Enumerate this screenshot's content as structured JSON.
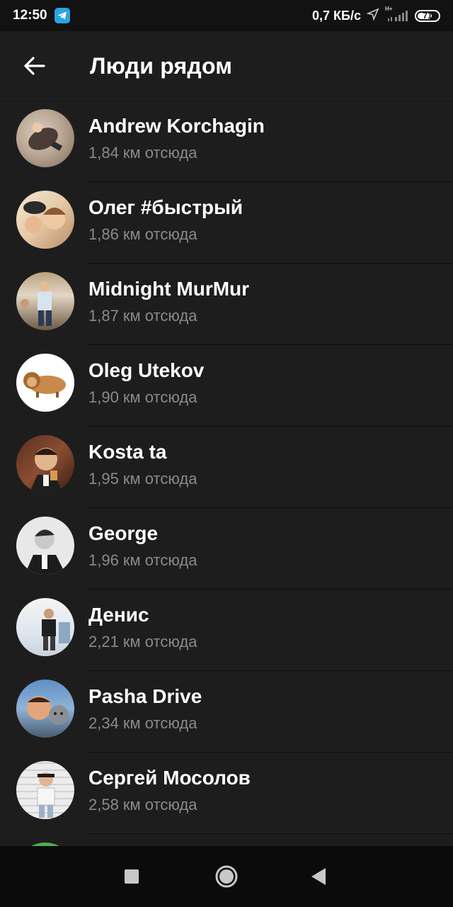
{
  "status_bar": {
    "time": "12:50",
    "speed": "0,7 КБ/с",
    "battery": "71",
    "battery_level": 0.71,
    "network": "H+"
  },
  "app_bar": {
    "back_icon": "arrow-left-icon",
    "title": "Люди рядом"
  },
  "people": [
    {
      "name": "Andrew Korchagin",
      "distance": "1,84 км отсюда"
    },
    {
      "name": "Олег #быстрый",
      "distance": "1,86 км отсюда"
    },
    {
      "name": "Midnight MurMur",
      "distance": "1,87 км отсюда"
    },
    {
      "name": "Oleg Utekov",
      "distance": "1,90 км отсюда"
    },
    {
      "name": "Kosta ta",
      "distance": "1,95 км отсюда"
    },
    {
      "name": "George",
      "distance": "1,96 км отсюда"
    },
    {
      "name": "Денис",
      "distance": "2,21 км отсюда"
    },
    {
      "name": "Pasha Drive",
      "distance": "2,34 км отсюда"
    },
    {
      "name": "Сергей Мосолов",
      "distance": "2,58 км отсюда"
    }
  ],
  "nav_bar": {
    "recents_icon": "square-icon",
    "home_icon": "circle-icon",
    "back_icon": "triangle-back-icon"
  },
  "colors": {
    "background": "#1d1d1d",
    "status_bar": "#121212",
    "nav_bar": "#0b0b0b",
    "secondary_text": "#8a8a8a"
  }
}
